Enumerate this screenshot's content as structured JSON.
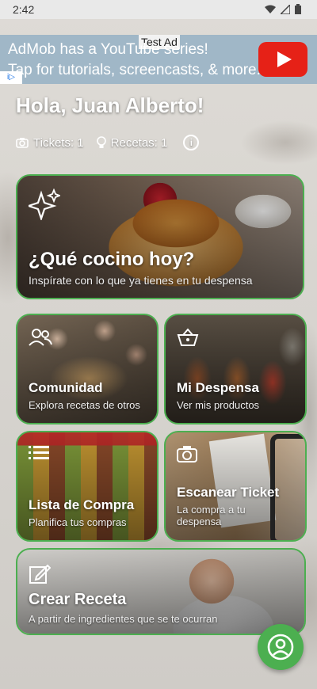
{
  "status_bar": {
    "time": "2:42"
  },
  "ad": {
    "badge": "Test Ad",
    "line1": "AdMob has a YouTube series!",
    "line2": "Tap for tutorials, screencasts, & more."
  },
  "greeting": "Hola, Juan Alberto!",
  "stats": {
    "tickets": "Tickets: 1",
    "recipes": "Recetas: 1"
  },
  "cards": {
    "cook": {
      "title": "¿Qué cocino hoy?",
      "subtitle": "Inspírate con lo que ya tienes en tu despensa"
    },
    "community": {
      "title": "Comunidad",
      "subtitle": "Explora recetas de otros"
    },
    "pantry": {
      "title": "Mi Despensa",
      "subtitle": "Ver mis productos"
    },
    "shopping": {
      "title": "Lista de Compra",
      "subtitle": "Planifica tus compras"
    },
    "ticket": {
      "title": "Escanear Ticket",
      "subtitle": "La compra a tu despensa"
    },
    "recipe": {
      "title": "Crear Receta",
      "subtitle": "A partir de ingredientes que se te ocurran"
    }
  },
  "colors": {
    "accent": "#4caf50",
    "ad_red": "#e62117"
  }
}
